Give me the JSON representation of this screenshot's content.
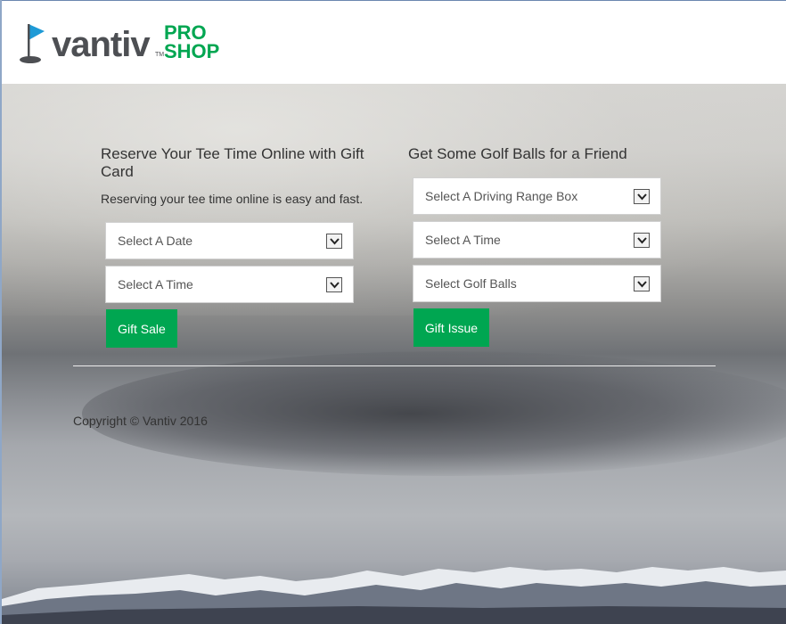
{
  "header": {
    "logo": {
      "wordmark": "vantiv",
      "trademark": "TM",
      "pro": "PRO",
      "shop": "SHOP"
    }
  },
  "left_column": {
    "title": "Reserve Your Tee Time Online with Gift Card",
    "subtitle": "Reserving your tee time online is easy and fast.",
    "date_select": "Select A Date",
    "time_select": "Select A Time",
    "button": "Gift Sale"
  },
  "right_column": {
    "title": "Get Some Golf Balls for a Friend",
    "range_select": "Select A Driving Range Box",
    "time_select": "Select A Time",
    "balls_select": "Select Golf Balls",
    "button": "Gift Issue"
  },
  "footer": {
    "copyright": "Copyright © Vantiv 2016"
  },
  "colors": {
    "brand_green": "#00a651",
    "text_dark": "#333333",
    "logo_gray": "#4d4f53",
    "flag_blue": "#1e9ad6"
  },
  "icons": [
    "golf-flag-icon",
    "chevron-down-icon"
  ]
}
